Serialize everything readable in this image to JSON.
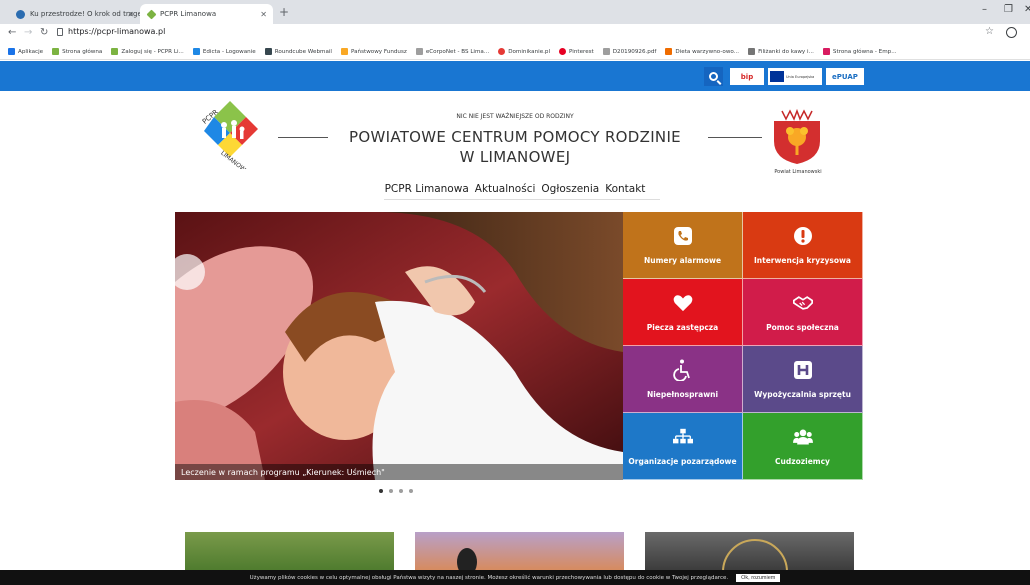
{
  "browser": {
    "tabs": [
      {
        "title": "Ku przestrodze! O krok od trage...",
        "active": false
      },
      {
        "title": "PCPR Limanowa",
        "active": true
      }
    ],
    "url": "https://pcpr-limanowa.pl",
    "bookmarks": [
      "Aplikacje",
      "Strona główna",
      "Zaloguj się - PCPR Li...",
      "Edicta - Logowanie",
      "Roundcube Webmail",
      "Państwowy Fundusz",
      "eCorpoNet - BS Lima...",
      "Dominikanie.pl",
      "Pinterest",
      "D20190926.pdf",
      "Dieta warzywno-owo...",
      "Filiżanki do kawy i...",
      "Strona główna - Emp..."
    ]
  },
  "header": {
    "bip_label": "bip",
    "ue_label": "Unia Europejska",
    "epuap_label": "ePUAP",
    "motto": "NIC NIE JEST WAŻNIEJSZE OD RODZINY",
    "title_line1": "POWIATOWE CENTRUM POMOCY RODZINIE",
    "title_line2": "W LIMANOWEJ",
    "logo_text_top": "PCPR",
    "logo_text_bottom": "LIMANOWA",
    "crest_label": "Powiat  Limanowski"
  },
  "menu": [
    "PCPR Limanowa",
    "Aktualności",
    "Ogłoszenia",
    "Kontakt"
  ],
  "slider": {
    "caption": "Leczenie w ramach programu „Kierunek: Uśmiech\"",
    "slides": 4,
    "active_slide": 1
  },
  "tiles": [
    {
      "label": "Numery alarmowe",
      "color": "#c0731b",
      "icon": "phone-icon"
    },
    {
      "label": "Interwencja kryzysowa",
      "color": "#d93a12",
      "icon": "exclamation-icon"
    },
    {
      "label": "Piecza zastępcza",
      "color": "#e2141e",
      "icon": "heart-icon"
    },
    {
      "label": "Pomoc społeczna",
      "color": "#d11c4a",
      "icon": "handshake-icon"
    },
    {
      "label": "Niepełnosprawni",
      "color": "#8a3286",
      "icon": "wheelchair-icon"
    },
    {
      "label": "Wypożyczalnia sprzętu",
      "color": "#5b4a8a",
      "icon": "hospital-icon"
    },
    {
      "label": "Organizacje pozarządowe",
      "color": "#1e78c8",
      "icon": "org-chart-icon"
    },
    {
      "label": "Cudzoziemcy",
      "color": "#33a02c",
      "icon": "people-icon"
    }
  ],
  "cookie": {
    "text": "Używamy plików cookies w celu optymalnej obsługi Państwa wizyty na naszej stronie. Możesz określić warunki przechowywania lub dostępu do cookie w Twojej przeglądarce.",
    "button": "Ok, rozumiem"
  }
}
